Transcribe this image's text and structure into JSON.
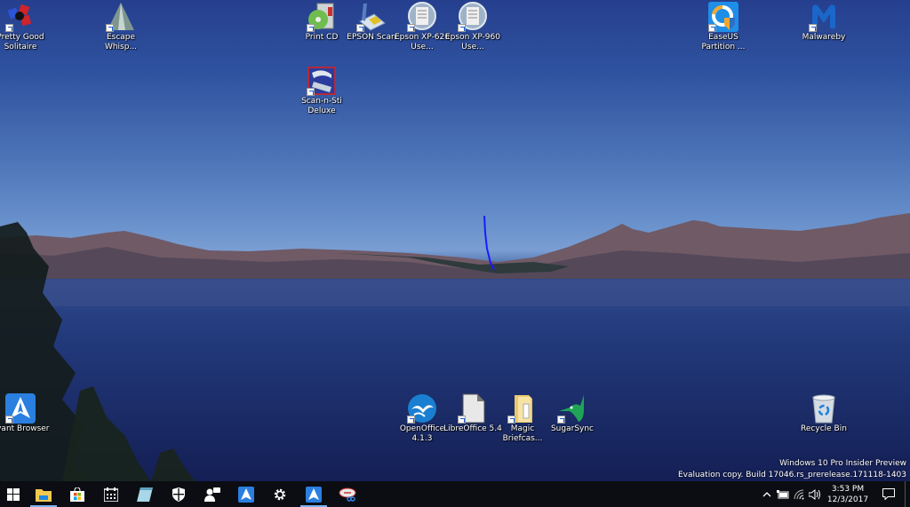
{
  "desktop": {
    "icons": [
      {
        "name": "pretty-good-solitaire",
        "label": "Pretty Good Solitaire",
        "icon": "cards-icon"
      },
      {
        "name": "escape-whisper",
        "label": "Escape Whisp...",
        "icon": "mountain-icon"
      },
      {
        "name": "print-cd",
        "label": "Print CD",
        "icon": "cd-icon"
      },
      {
        "name": "epson-scan",
        "label": "EPSON Scan",
        "icon": "scanner-icon"
      },
      {
        "name": "epson-xp620",
        "label": "Epson XP-620 Use...",
        "icon": "document-icon"
      },
      {
        "name": "epson-xp960",
        "label": "Epson XP-960 Use...",
        "icon": "document-icon"
      },
      {
        "name": "scan-n-stitch",
        "label": "Scan-n-Sti Deluxe",
        "icon": "scan-stitch-icon"
      },
      {
        "name": "easeus-partition",
        "label": "EaseUS Partition ...",
        "icon": "easeus-icon"
      },
      {
        "name": "malwarebytes",
        "label": "Malwareby",
        "icon": "malwarebytes-icon"
      },
      {
        "name": "avant-browser",
        "label": "Avant Browser",
        "icon": "avant-icon"
      },
      {
        "name": "openoffice",
        "label": "OpenOffice 4.1.3",
        "icon": "openoffice-icon"
      },
      {
        "name": "libreoffice",
        "label": "LibreOffice 5.4",
        "icon": "libreoffice-icon"
      },
      {
        "name": "magic-briefcase",
        "label": "Magic Briefcas...",
        "icon": "folder-icon"
      },
      {
        "name": "sugarsync",
        "label": "SugarSync",
        "icon": "hummingbird-icon"
      },
      {
        "name": "recycle-bin",
        "label": "Recycle Bin",
        "icon": "recycle-bin-icon"
      }
    ],
    "watermark": {
      "line1": "Windows 10 Pro Insider Preview",
      "line2": "Evaluation copy. Build 17046.rs_prerelease.171118-1403"
    }
  },
  "taskbar": {
    "buttons": [
      {
        "name": "start",
        "icon": "windows-logo-icon",
        "active": false
      },
      {
        "name": "file-explorer",
        "icon": "folder-icon",
        "active": true
      },
      {
        "name": "store",
        "icon": "store-bag-icon",
        "active": false
      },
      {
        "name": "calendar",
        "icon": "calendar-icon",
        "active": false
      },
      {
        "name": "notepad",
        "icon": "notepad-icon",
        "active": false
      },
      {
        "name": "windows-defender",
        "icon": "shield-icon",
        "active": false
      },
      {
        "name": "people",
        "icon": "people-icon",
        "active": false
      },
      {
        "name": "avant-browser",
        "icon": "avant-icon",
        "active": false
      },
      {
        "name": "settings",
        "icon": "gear-icon",
        "active": false
      },
      {
        "name": "avant-browser-2",
        "icon": "avant-icon",
        "active": true
      },
      {
        "name": "snipping-tool",
        "icon": "scissors-icon",
        "active": false
      }
    ],
    "tray": {
      "icons": [
        "chevron-up-icon",
        "battery-icon",
        "wifi-icon",
        "volume-icon"
      ],
      "time": "3:53 PM",
      "date": "12/3/2017"
    }
  },
  "colors": {
    "taskbar_bg": "#0b0d12",
    "active_indicator": "#7eb2f0"
  }
}
